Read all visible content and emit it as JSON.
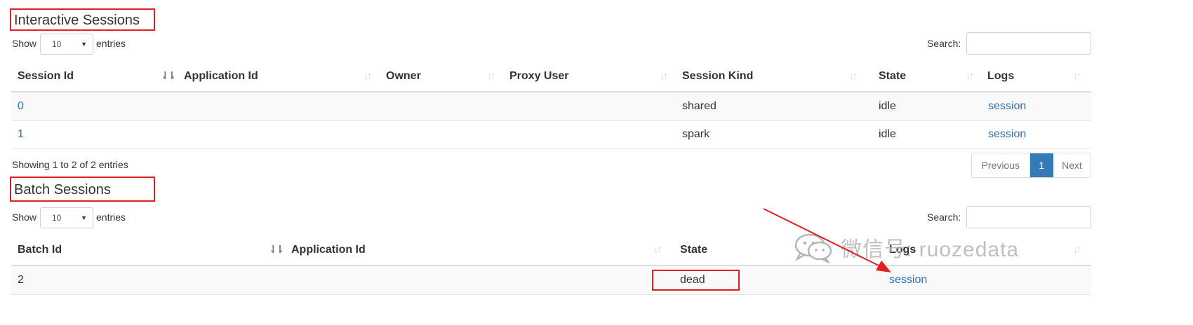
{
  "interactive": {
    "title": "Interactive Sessions",
    "show_label": "Show",
    "page_size": "10",
    "entries_label": "entries",
    "search_label": "Search:",
    "search_value": "",
    "columns": [
      "Session Id",
      "Application Id",
      "Owner",
      "Proxy User",
      "Session Kind",
      "State",
      "Logs"
    ],
    "rows": [
      {
        "id": "0",
        "app_id": "",
        "owner": "",
        "proxy_user": "",
        "kind": "shared",
        "state": "idle",
        "logs": "session"
      },
      {
        "id": "1",
        "app_id": "",
        "owner": "",
        "proxy_user": "",
        "kind": "spark",
        "state": "idle",
        "logs": "session"
      }
    ],
    "info": "Showing 1 to 2 of 2 entries",
    "pager": {
      "previous": "Previous",
      "current": "1",
      "next": "Next"
    }
  },
  "batch": {
    "title": "Batch Sessions",
    "show_label": "Show",
    "page_size": "10",
    "entries_label": "entries",
    "search_label": "Search:",
    "search_value": "",
    "columns": [
      "Batch Id",
      "Application Id",
      "State",
      "Logs"
    ],
    "rows": [
      {
        "id": "2",
        "app_id": "",
        "state": "dead",
        "logs": "session"
      }
    ]
  },
  "watermark": "微信号: ruozedata",
  "icons": {
    "sort": "sort-icon",
    "sort_active": "sort-asc-icon",
    "select_caret": "caret-down-icon",
    "wechat": "wechat-icon",
    "arrow": "red-arrow-icon"
  },
  "colors": {
    "link": "#2a72b5",
    "annotation": "#e0201f",
    "active_page": "#337ab7"
  }
}
